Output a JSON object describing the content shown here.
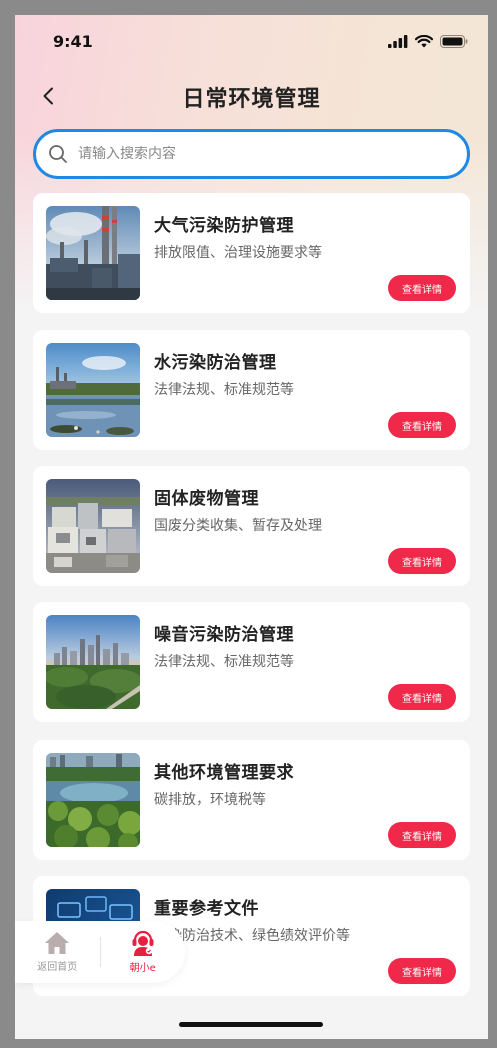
{
  "status": {
    "time": "9:41"
  },
  "header": {
    "title": "日常环境管理"
  },
  "search": {
    "placeholder": "请输入搜索内容"
  },
  "cards": [
    {
      "title": "大气污染防护管理",
      "desc": "排放限值、治理设施要求等",
      "button": "查看详情"
    },
    {
      "title": "水污染防治管理",
      "desc": "法律法规、标准规范等",
      "button": "查看详情"
    },
    {
      "title": "固体废物管理",
      "desc": "国废分类收集、暂存及处理",
      "button": "查看详情"
    },
    {
      "title": "噪音污染防治管理",
      "desc": "法律法规、标准规范等",
      "button": "查看详情"
    },
    {
      "title": "其他环境管理要求",
      "desc": "碳排放，环境税等",
      "button": "查看详情"
    },
    {
      "title": "重要参考文件",
      "desc": "污染防治技术、绿色绩效评价等",
      "button": "查看详情"
    }
  ],
  "float_nav": {
    "home_label": "返回首页",
    "assistant_label": "朝小e"
  },
  "colors": {
    "accent_blue": "#1e8ae6",
    "button_red": "#f0294a",
    "home_icon": "#b9adb0",
    "assistant_icon": "#e81f3e"
  }
}
